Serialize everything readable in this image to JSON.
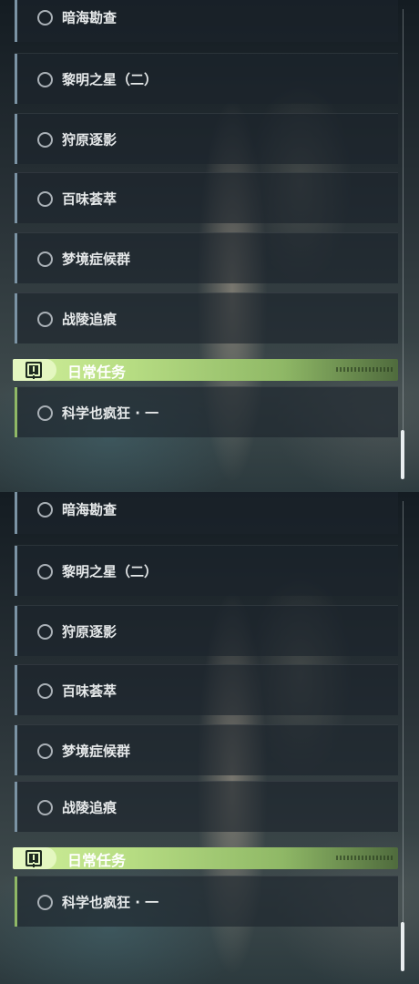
{
  "panels": [
    {
      "items": [
        {
          "label": "暗海勘查"
        },
        {
          "label": "黎明之星（二）"
        },
        {
          "label": "狩原逐影"
        },
        {
          "label": "百味荟萃"
        },
        {
          "label": "梦境症候群"
        },
        {
          "label": "战陵追痕"
        }
      ],
      "section": {
        "title": "日常任务",
        "icon": "alert-icon"
      },
      "section_items": [
        {
          "label": "科学也疯狂 · 一"
        }
      ]
    },
    {
      "items": [
        {
          "label": "暗海勘查"
        },
        {
          "label": "黎明之星（二）"
        },
        {
          "label": "狩原逐影"
        },
        {
          "label": "百味荟萃"
        },
        {
          "label": "梦境症候群"
        },
        {
          "label": "战陵追痕"
        }
      ],
      "section": {
        "title": "日常任务",
        "icon": "alert-icon"
      },
      "section_items": [
        {
          "label": "科学也疯狂 · 一"
        }
      ]
    }
  ],
  "colors": {
    "main_quest_accent": "#7b93a4",
    "daily_accent": "#8fb866",
    "daily_header": "#b7dd83",
    "text": "#e6e9ea"
  },
  "scroll_position": 1.0
}
